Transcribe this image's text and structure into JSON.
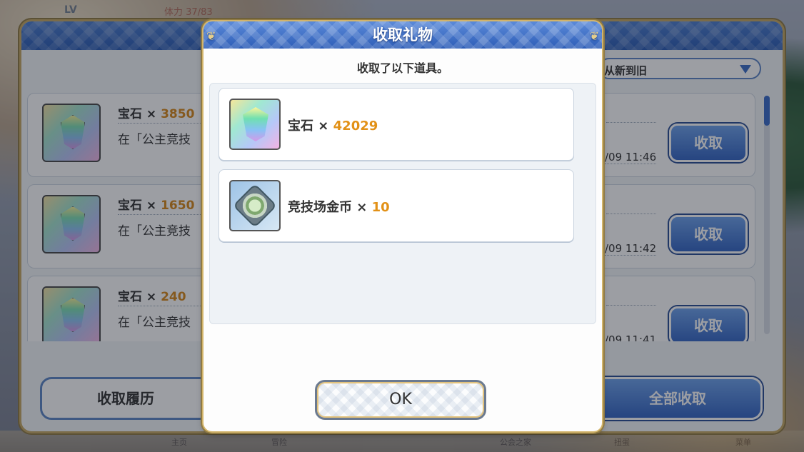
{
  "background": {
    "hud": {
      "level_prefix": "LV",
      "stamina_label": "体力",
      "stamina_value": "37/83"
    },
    "nav": [
      "主页",
      "冒险",
      "公会之家",
      "扭蛋",
      "菜单"
    ]
  },
  "gift_list": {
    "sort": {
      "label": "从新到旧",
      "icon": "chevron-down-icon"
    },
    "rows": [
      {
        "item": "宝石",
        "times": "×",
        "amount": "3850",
        "desc": "在「公主竞技",
        "time": "/09 11:46",
        "claim_label": "收取"
      },
      {
        "item": "宝石",
        "times": "×",
        "amount": "1650",
        "desc": "在「公主竞技",
        "time": "/09 11:42",
        "claim_label": "收取"
      },
      {
        "item": "宝石",
        "times": "×",
        "amount": "240",
        "desc": "在「公主竞技",
        "time": "/09 11:41",
        "claim_label": "收取"
      }
    ],
    "history_button": "收取履历",
    "claim_all_button": "全部收取"
  },
  "modal": {
    "title": "收取礼物",
    "subtitle": "收取了以下道具。",
    "items": [
      {
        "name": "宝石",
        "times": "×",
        "amount": "42029",
        "icon": "gem-icon"
      },
      {
        "name": "竞技场金币",
        "times": "×",
        "amount": "10",
        "icon": "arena-coin-icon"
      }
    ],
    "ok_button": "OK"
  }
}
